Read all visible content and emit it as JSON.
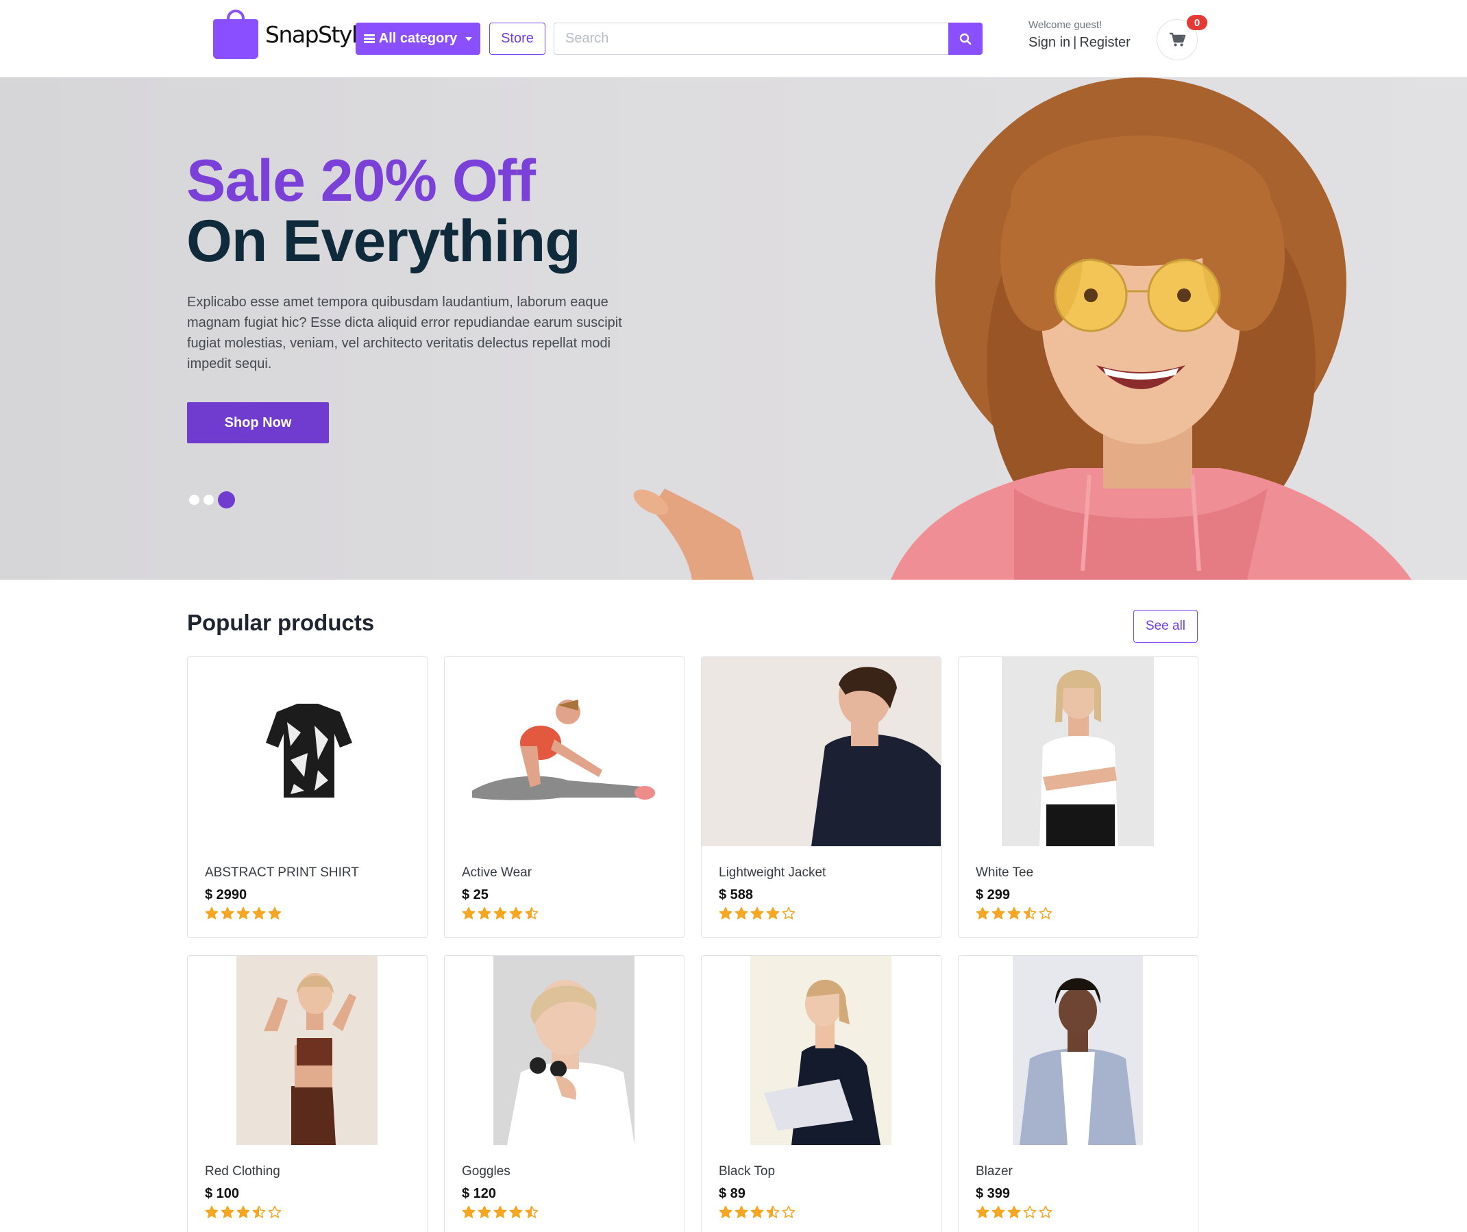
{
  "header": {
    "brand": "SnapStyle",
    "category_label": "All category",
    "store_label": "Store",
    "search_placeholder": "Search",
    "welcome": "Welcome guest!",
    "sign_in": "Sign in",
    "separator": "|",
    "register": "Register",
    "cart_count": "0",
    "accent_color": "#8a4fff"
  },
  "hero": {
    "headline_1": "Sale 20% Off",
    "headline_2": "On Everything",
    "description": "Explicabo esse amet tempora quibusdam laudantium, laborum eaque magnam fugiat hic? Esse dicta aliquid error repudiandae earum suscipit fugiat molestias, veniam, vel architecto veritatis delectus repellat modi impedit sequi.",
    "cta": "Shop Now",
    "slides": 3,
    "active_slide": 3
  },
  "products_section": {
    "title": "Popular products",
    "see_all": "See all",
    "items": [
      {
        "name": "ABSTRACT PRINT SHIRT",
        "price": "$ 2990",
        "rating": 5
      },
      {
        "name": "Active Wear",
        "price": "$ 25",
        "rating": 4.5
      },
      {
        "name": "Lightweight Jacket",
        "price": "$ 588",
        "rating": 4
      },
      {
        "name": "White Tee",
        "price": "$ 299",
        "rating": 3.5
      },
      {
        "name": "Red Clothing",
        "price": "$ 100",
        "rating": 3.5
      },
      {
        "name": "Goggles",
        "price": "$ 120",
        "rating": 4.5
      },
      {
        "name": "Black Top",
        "price": "$ 89",
        "rating": 3.5
      },
      {
        "name": "Blazer",
        "price": "$ 399",
        "rating": 3
      }
    ]
  }
}
